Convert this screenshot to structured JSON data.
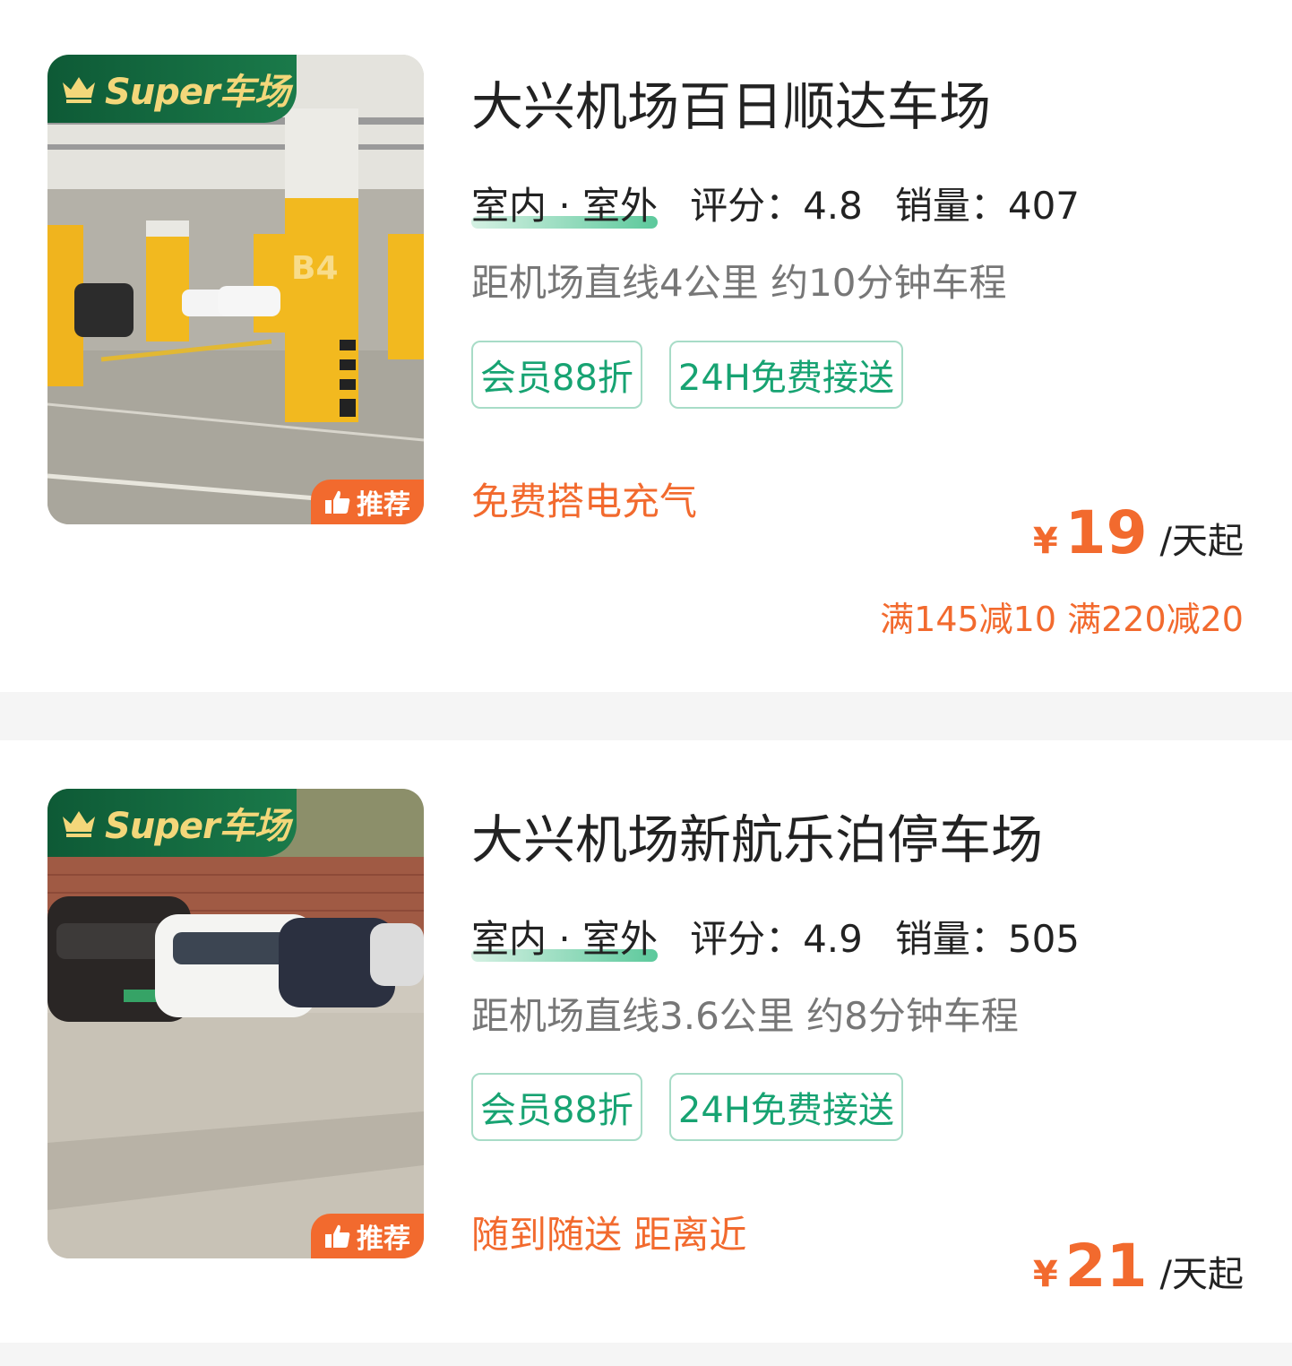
{
  "lots": [
    {
      "badge": "Super车场",
      "recommend_label": "推荐",
      "title": "大兴机场百日顺达车场",
      "type": "室内 · 室外",
      "rating": "评分：4.8",
      "sales": "销量：407",
      "distance": "距机场直线4公里 约10分钟车程",
      "tags": [
        "会员88折",
        "24H免费接送"
      ],
      "highlight": "免费搭电充气",
      "currency": "¥",
      "price": "19",
      "price_unit": "/天起",
      "discount": "满145减10 满220减20",
      "photo": "underground-parking-photo"
    },
    {
      "badge": "Super车场",
      "recommend_label": "推荐",
      "title": "大兴机场新航乐泊停车场",
      "type": "室内 · 室外",
      "rating": "评分：4.9",
      "sales": "销量：505",
      "distance": "距机场直线3.6公里 约8分钟车程",
      "tags": [
        "会员88折",
        "24H免费接送"
      ],
      "highlight": "随到随送 距离近",
      "currency": "¥",
      "price": "21",
      "price_unit": "/天起",
      "photo": "outdoor-parking-photo"
    }
  ],
  "colors": {
    "accent_orange": "#f26a2e",
    "accent_green": "#17a372",
    "badge_green": "#0e5a36",
    "badge_gold": "#f3d77a"
  }
}
